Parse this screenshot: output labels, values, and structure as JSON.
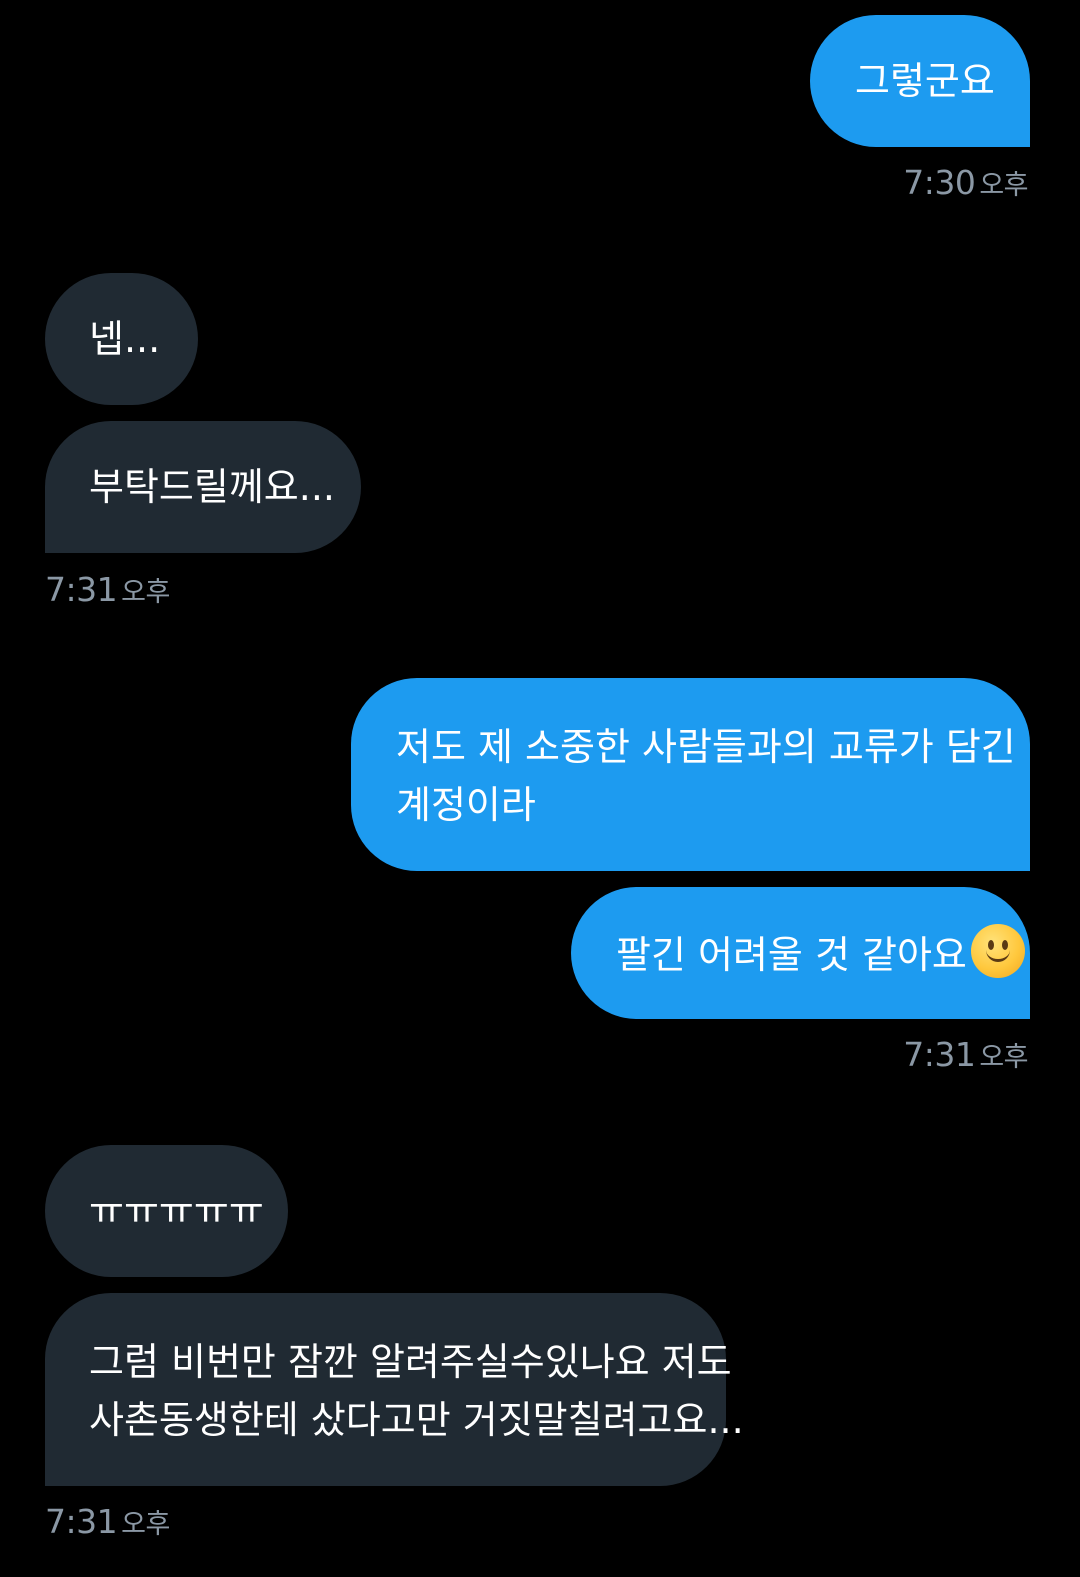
{
  "messages": [
    {
      "side": "sent",
      "text": "그렇군요"
    },
    {
      "side": "received",
      "text": "넵..."
    },
    {
      "side": "received",
      "text": "부탁드릴께요..."
    },
    {
      "side": "sent",
      "lines": [
        "저도 제 소중한 사람들과의 교류가 담긴",
        "계정이라"
      ]
    },
    {
      "side": "sent",
      "text": "팔긴 어려울 것 같아요",
      "emoji": "slightly-smiling-face"
    },
    {
      "side": "received",
      "text": "ㅠㅠㅠㅠㅠ"
    },
    {
      "side": "received",
      "lines": [
        "그럼 비번만 잠깐 알려주실수있나요 저도",
        "사촌동생한테 샀다고만 거짓말칠려고요..."
      ]
    }
  ],
  "timestamps": [
    {
      "time": "7:30",
      "ampm": "오후"
    },
    {
      "time": "7:31",
      "ampm": "오후"
    },
    {
      "time": "7:31",
      "ampm": "오후"
    },
    {
      "time": "7:31",
      "ampm": "오후"
    }
  ],
  "colors": {
    "background": "#000000",
    "sent_bubble": "#1d9bf0",
    "received_bubble": "#202a33",
    "timestamp": "#8b98a5"
  }
}
